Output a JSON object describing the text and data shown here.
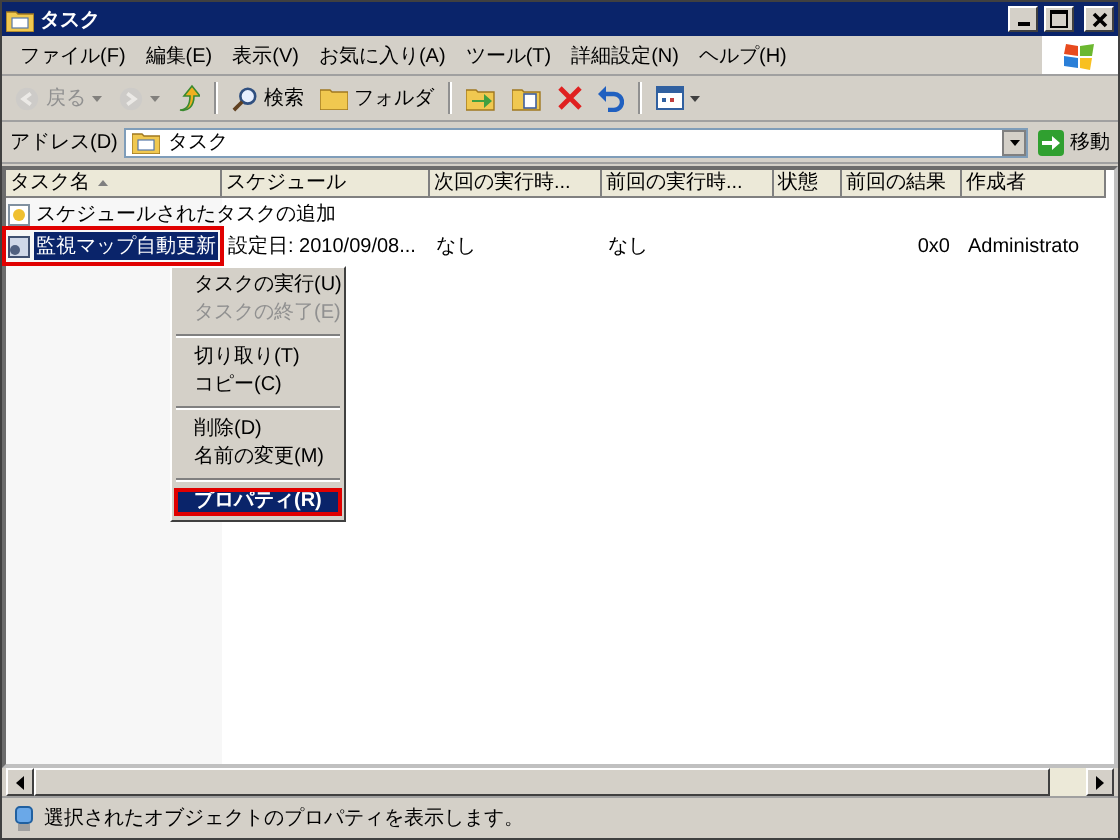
{
  "window": {
    "title": "タスク"
  },
  "menu": [
    "ファイル(F)",
    "編集(E)",
    "表示(V)",
    "お気に入り(A)",
    "ツール(T)",
    "詳細設定(N)",
    "ヘルプ(H)"
  ],
  "toolbar": [
    {
      "kind": "button",
      "label": "戻る",
      "disabled": true
    },
    {
      "kind": "button",
      "disabled": true
    },
    {
      "kind": "button",
      "disabled": false
    },
    {
      "kind": "separator"
    },
    {
      "kind": "button",
      "label": "検索",
      "disabled": false
    },
    {
      "kind": "button",
      "label": "フォルダ",
      "disabled": false
    },
    {
      "kind": "separator"
    },
    {
      "kind": "button",
      "disabled": false
    },
    {
      "kind": "button",
      "disabled": false
    },
    {
      "kind": "button",
      "disabled": false
    },
    {
      "kind": "button",
      "disabled": false
    },
    {
      "kind": "separator"
    },
    {
      "kind": "button",
      "disabled": false
    }
  ],
  "address": {
    "label": "アドレス(D)",
    "value": "タスク",
    "go": "移動"
  },
  "table": {
    "columns": [
      "タスク名",
      "スケジュール",
      "次回の実行時...",
      "前回の実行時...",
      "状態",
      "前回の結果",
      "作成者"
    ],
    "rows": [
      {
        "kind": "add",
        "selected": false,
        "outlined": false,
        "cells": [
          "スケジュールされたタスクの追加"
        ]
      },
      {
        "kind": "task",
        "selected": true,
        "outlined": true,
        "cells": [
          "監視マップ自動更新",
          "設定日: 2010/09/08...",
          "なし",
          "なし",
          "",
          "0x0",
          "Administrato"
        ]
      }
    ]
  },
  "context_menu": [
    {
      "kind": "item",
      "label": "タスクの実行(U)",
      "disabled": false,
      "selected": false,
      "outlined": false
    },
    {
      "kind": "item",
      "label": "タスクの終了(E)",
      "disabled": true,
      "selected": false,
      "outlined": false
    },
    {
      "kind": "separator"
    },
    {
      "kind": "item",
      "label": "切り取り(T)",
      "disabled": false,
      "selected": false,
      "outlined": false
    },
    {
      "kind": "item",
      "label": "コピー(C)",
      "disabled": false,
      "selected": false,
      "outlined": false
    },
    {
      "kind": "separator"
    },
    {
      "kind": "item",
      "label": "削除(D)",
      "disabled": false,
      "selected": false,
      "outlined": false
    },
    {
      "kind": "item",
      "label": "名前の変更(M)",
      "disabled": false,
      "selected": false,
      "outlined": false
    },
    {
      "kind": "separator"
    },
    {
      "kind": "item",
      "label": "プロパティ(R)",
      "disabled": false,
      "selected": true,
      "outlined": true
    }
  ],
  "status_bar": "選択されたオブジェクトのプロパティを表示します。"
}
